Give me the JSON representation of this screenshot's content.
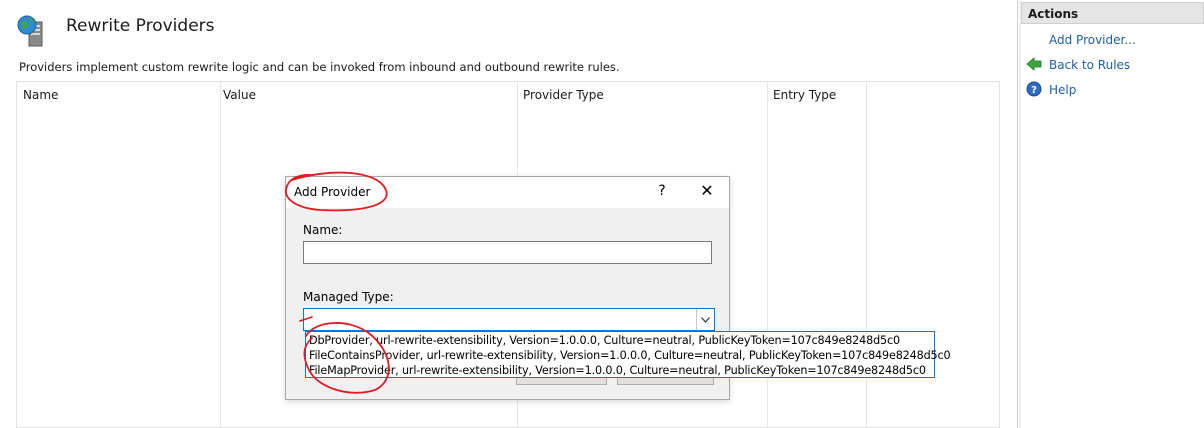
{
  "page": {
    "title": "Rewrite Providers",
    "description": "Providers implement custom rewrite logic and can be invoked from inbound and outbound rewrite rules.",
    "icon": "globe-server-icon"
  },
  "grid": {
    "columns": [
      "Name",
      "Value",
      "Provider Type",
      "Entry Type"
    ]
  },
  "dialog": {
    "title": "Add Provider",
    "help_glyph": "?",
    "close_glyph": "✕",
    "name_label": "Name:",
    "name_value": "",
    "managed_type_label": "Managed Type:",
    "managed_type_value": "",
    "managed_type_options": [
      "DbProvider, url-rewrite-extensibility, Version=1.0.0.0, Culture=neutral, PublicKeyToken=107c849e8248d5c0",
      "FileContainsProvider, url-rewrite-extensibility, Version=1.0.0.0, Culture=neutral, PublicKeyToken=107c849e8248d5c0",
      "FileMapProvider, url-rewrite-extensibility, Version=1.0.0.0, Culture=neutral, PublicKeyToken=107c849e8248d5c0"
    ]
  },
  "actions": {
    "header": "Actions",
    "items": [
      {
        "label": "Add Provider...",
        "icon": ""
      },
      {
        "label": "Back to Rules",
        "icon": "back-arrow-icon"
      },
      {
        "label": "Help",
        "icon": "help-icon"
      }
    ]
  },
  "colors": {
    "link": "#1f5fa8",
    "annotation": "#e01b24",
    "focus_border": "#0078d7"
  }
}
